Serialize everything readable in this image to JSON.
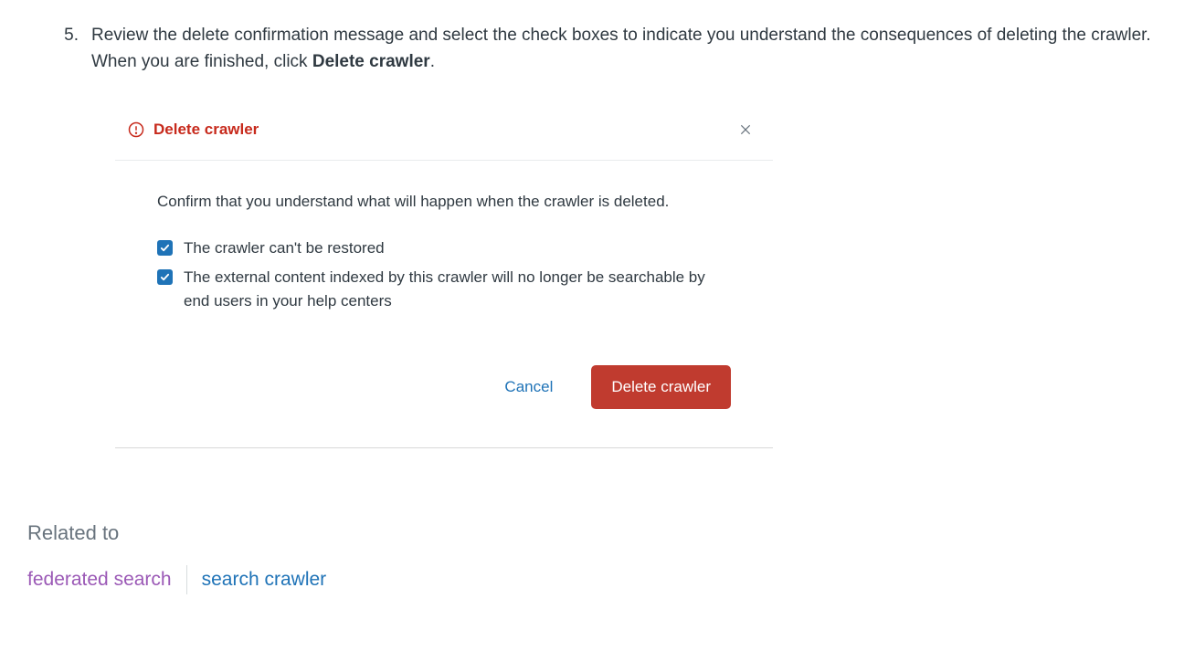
{
  "step": {
    "number": "5.",
    "text_before": "Review the delete confirmation message and select the check boxes to indicate you understand the consequences of deleting the crawler. When you are finished, click ",
    "bold": "Delete crawler",
    "text_after": "."
  },
  "modal": {
    "title": "Delete crawler",
    "confirm_text": "Confirm that you understand what will happen when the crawler is deleted.",
    "checkbox1": "The crawler can't be restored",
    "checkbox2": "The external content indexed by this crawler will no longer be searchable by end users in your help centers",
    "cancel_label": "Cancel",
    "delete_label": "Delete crawler"
  },
  "related": {
    "heading": "Related to",
    "link1": "federated search",
    "link2": "search crawler"
  }
}
